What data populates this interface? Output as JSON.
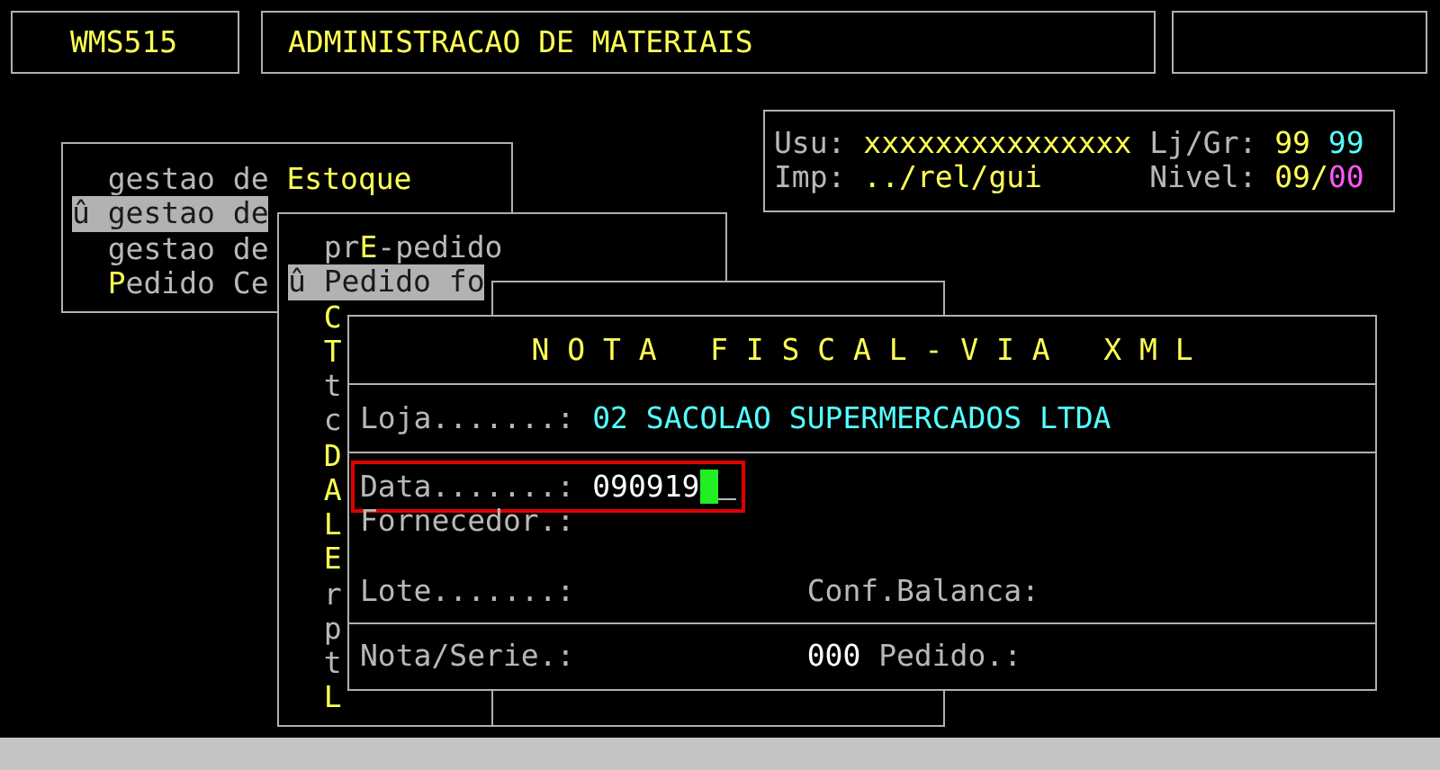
{
  "header": {
    "program_code": "WMS515",
    "title": "ADMINISTRACAO DE MATERIAIS"
  },
  "info": {
    "user_label": "Usu:",
    "user": "xxxxxxxxxxxxxxx",
    "store_group_label": "Lj/Gr:",
    "store": "99",
    "group": "99",
    "printer_label": "Imp:",
    "printer": "../rel/gui",
    "level_label": "Nivel:",
    "level": "09/",
    "sublevel": "00"
  },
  "menu": {
    "items": [
      {
        "selected": false,
        "segments": [
          {
            "text": "gestao de ",
            "hot": false
          },
          {
            "text": "Estoque",
            "hot": true
          }
        ]
      },
      {
        "selected": true,
        "segments": [
          {
            "text": "û gestao de"
          }
        ]
      },
      {
        "selected": false,
        "segments": [
          {
            "text": "gestao de",
            "hot": false
          }
        ]
      },
      {
        "selected": false,
        "segments": [
          {
            "text": "P",
            "hot": true
          },
          {
            "text": "edido Ce",
            "hot": false
          }
        ]
      }
    ]
  },
  "submenu": {
    "items": [
      {
        "selected": false,
        "segments": [
          {
            "text": "pr",
            "hot": false
          },
          {
            "text": "E",
            "hot": true
          },
          {
            "text": "-pedido",
            "hot": false
          }
        ]
      },
      {
        "selected": true,
        "segments": [
          {
            "text": "û Pedido fo"
          }
        ]
      },
      {
        "selected": false,
        "segments": [
          {
            "text": "C",
            "hot": true
          }
        ]
      },
      {
        "selected": false,
        "segments": [
          {
            "text": "T",
            "hot": true
          }
        ]
      },
      {
        "selected": false,
        "segments": [
          {
            "text": "t",
            "hot": false
          }
        ]
      },
      {
        "selected": false,
        "segments": [
          {
            "text": "c",
            "hot": false
          }
        ]
      },
      {
        "selected": false,
        "segments": [
          {
            "text": "D",
            "hot": true
          }
        ]
      },
      {
        "selected": false,
        "segments": [
          {
            "text": "A",
            "hot": true
          }
        ]
      },
      {
        "selected": false,
        "segments": [
          {
            "text": "L",
            "hot": true
          }
        ]
      },
      {
        "selected": false,
        "segments": [
          {
            "text": "E",
            "hot": true
          }
        ]
      },
      {
        "selected": false,
        "segments": [
          {
            "text": "r",
            "hot": false
          }
        ]
      },
      {
        "selected": false,
        "segments": [
          {
            "text": "p",
            "hot": false
          }
        ]
      },
      {
        "selected": false,
        "segments": [
          {
            "text": "t",
            "hot": false
          }
        ]
      },
      {
        "selected": false,
        "segments": [
          {
            "text": "L",
            "hot": true
          }
        ]
      }
    ]
  },
  "form": {
    "title": "N O T A   F I S C A L - V I A   X M L",
    "sections": [
      {
        "rows": [
          [
            {
              "label": "Loja.......:",
              "value": "02 SACOLAO SUPERMERCADOS LTDA",
              "kind": "display"
            }
          ]
        ]
      },
      {
        "rows": [
          [
            {
              "label": "Data.......:",
              "value": "090919",
              "kind": "input",
              "cursor": true,
              "highlighted": true
            }
          ],
          [
            {
              "label": "Fornecedor.:"
            }
          ],
          [
            {
              "label": "Lote.......:"
            },
            {
              "label": "Conf.Balanca:"
            }
          ]
        ]
      },
      {
        "rows": [
          [
            {
              "label": "Nota/Serie.:",
              "value": "000",
              "kind": "input"
            },
            {
              "label": "Pedido.:"
            }
          ]
        ]
      }
    ]
  }
}
